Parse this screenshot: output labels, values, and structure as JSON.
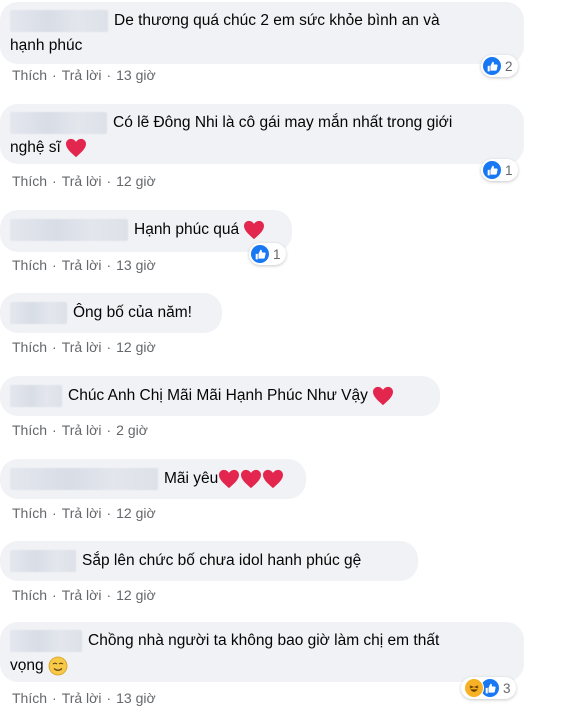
{
  "colors": {
    "bubble": "#f0f2f5",
    "like_blue": "#1877f2",
    "heart_red": "#e2264d",
    "meta_gray": "#65676b"
  },
  "actions": {
    "like": "Thích",
    "reply": "Trả lời",
    "dot": "·"
  },
  "comments": [
    {
      "text_line1": "De thương quá chúc 2 em sức khỏe bình an và",
      "text_line2": "hạnh phúc",
      "time": "13 giờ",
      "reactions": "2"
    },
    {
      "text_line1": "Có lẽ Đông Nhi là cô gái may mắn nhất trong giới",
      "text_line2": "nghệ sĩ",
      "time": "12 giờ",
      "reactions": "1"
    },
    {
      "text": "Hạnh phúc quá",
      "time": "13 giờ",
      "reactions": "1"
    },
    {
      "text": "Ông bố của năm!",
      "time": "12 giờ"
    },
    {
      "text": "Chúc Anh Chị Mãi Mãi Hạnh Phúc Như Vậy",
      "time": "2 giờ"
    },
    {
      "text": "Mãi yêu",
      "time": "12 giờ"
    },
    {
      "text": "Sắp lên chức bố chưa idol hanh phúc gệ",
      "time": "12 giờ"
    },
    {
      "text_line1": "Chồng nhà người ta không bao giờ làm chị em thất",
      "text_line2": "vọng",
      "time": "13 giờ",
      "reactions": "3"
    }
  ]
}
